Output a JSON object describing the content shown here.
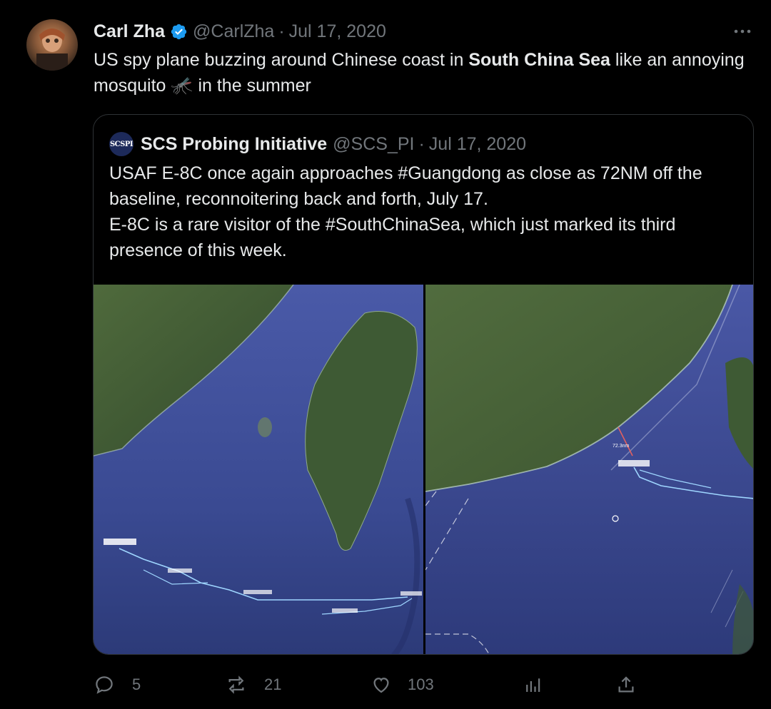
{
  "tweet": {
    "author_name": "Carl Zha",
    "handle": "@CarlZha",
    "separator": "·",
    "date": "Jul 17, 2020",
    "text_before": "US spy plane buzzing around Chinese coast in ",
    "text_bold": "South China Sea",
    "text_after": " like an annoying mosquito 🦟 in the summer"
  },
  "quote": {
    "avatar_text": "SCSPI",
    "author_name": "SCS Probing Initiative",
    "handle": "@SCS_PI",
    "separator": "·",
    "date": "Jul 17, 2020",
    "text_line1": "USAF E-8C once again approaches #Guangdong as close as 72NM off the baseline, reconnoitering back and forth, July 17.",
    "text_line2": "E-8C is a rare visitor of the #SouthChinaSea, which just marked its third presence of this week.",
    "right_map_label": "72.3nm"
  },
  "actions": {
    "replies": "5",
    "retweets": "21",
    "likes": "103"
  },
  "colors": {
    "background": "#000000",
    "text": "#e7e9ea",
    "muted": "#71767b",
    "verified": "#1d9bf0",
    "border": "#2f3336"
  }
}
